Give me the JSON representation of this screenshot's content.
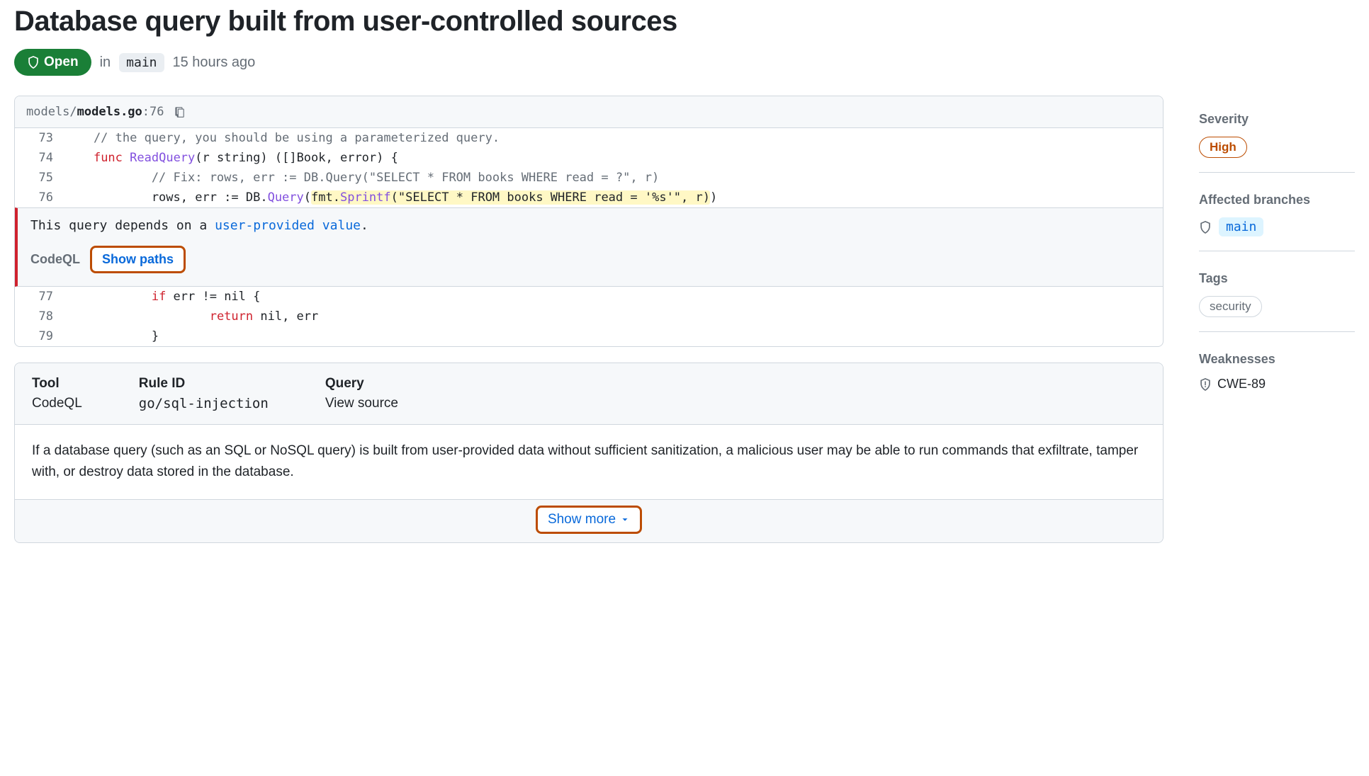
{
  "header": {
    "title": "Database query built from user-controlled sources",
    "state": "Open",
    "in_label": "in",
    "branch": "main",
    "age": "15 hours ago"
  },
  "code": {
    "path_dir": "models/",
    "path_file": "models.go",
    "path_sep": ":",
    "line": "76",
    "lines_top": [
      {
        "n": "73",
        "text": "    // the query, you should be using a parameterized query.",
        "cls": "cm"
      },
      {
        "n": "74"
      },
      {
        "n": "75",
        "text": "            // Fix: rows, err := DB.Query(\"SELECT * FROM books WHERE read = ?\", r)",
        "cls": "cm"
      },
      {
        "n": "76"
      }
    ],
    "l74": {
      "kw": "func",
      "fn": "ReadQuery",
      "rest": "(r string) ([]Book, error) {"
    },
    "l76": {
      "pre": "            rows, err := DB.",
      "q": "Query",
      "op": "(",
      "pkg": "fmt",
      "dot": ".",
      "sf": "Sprintf",
      "args": "(\"SELECT * FROM books WHERE read = '%s'\", r)",
      "cl": ")"
    },
    "lines_bottom": [
      {
        "n": "77"
      },
      {
        "n": "78"
      },
      {
        "n": "79",
        "text": "            }"
      }
    ],
    "l77": {
      "pre": "            ",
      "kw": "if",
      "rest": " err != nil {"
    },
    "l78": {
      "pre": "                    ",
      "kw": "return",
      "rest": " nil, err"
    }
  },
  "alert": {
    "msg_pre": "This query depends on a ",
    "msg_link": "user-provided value",
    "msg_post": ".",
    "tool": "CodeQL",
    "show_paths": "Show paths"
  },
  "details": {
    "tool_label": "Tool",
    "tool_value": "CodeQL",
    "rule_label": "Rule ID",
    "rule_value": "go/sql-injection",
    "query_label": "Query",
    "query_value": "View source",
    "description": "If a database query (such as an SQL or NoSQL query) is built from user-provided data without sufficient sanitization, a malicious user may be able to run commands that exfiltrate, tamper with, or destroy data stored in the database.",
    "show_more": "Show more"
  },
  "sidebar": {
    "severity_label": "Severity",
    "severity_value": "High",
    "branches_label": "Affected branches",
    "branch": "main",
    "tags_label": "Tags",
    "tag": "security",
    "weaknesses_label": "Weaknesses",
    "cwe": "CWE-89"
  }
}
